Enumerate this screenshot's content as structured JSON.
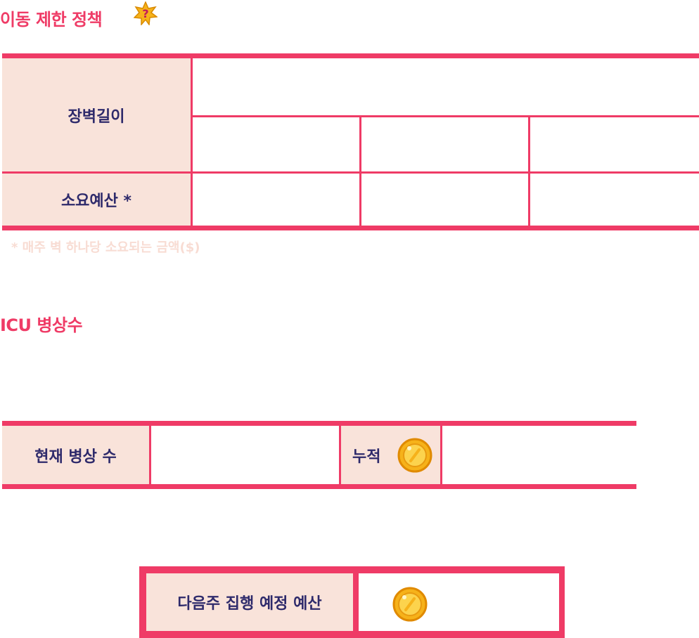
{
  "movement_policy": {
    "title": "이동 제한 정책",
    "wall_length_label": "장벽길이",
    "cost_label": "소요예산 *",
    "footnote": "* 매주 벽 하나당 소요되는 금액($)"
  },
  "icu": {
    "title": "ICU 병상수",
    "current_beds_label": "현재 병상 수",
    "cumulative_label": "누적"
  },
  "budget": {
    "next_week_label": "다음주 집행 예정 예산"
  },
  "icons": {
    "title_badge": "star-question-icon",
    "currency": "coin-icon"
  },
  "colors": {
    "accent": "#ef3b66",
    "label_bg": "#f9e3da",
    "label_text": "#2e2a6b",
    "footnote": "#f8dcd3",
    "coin": "#f6b21a"
  }
}
